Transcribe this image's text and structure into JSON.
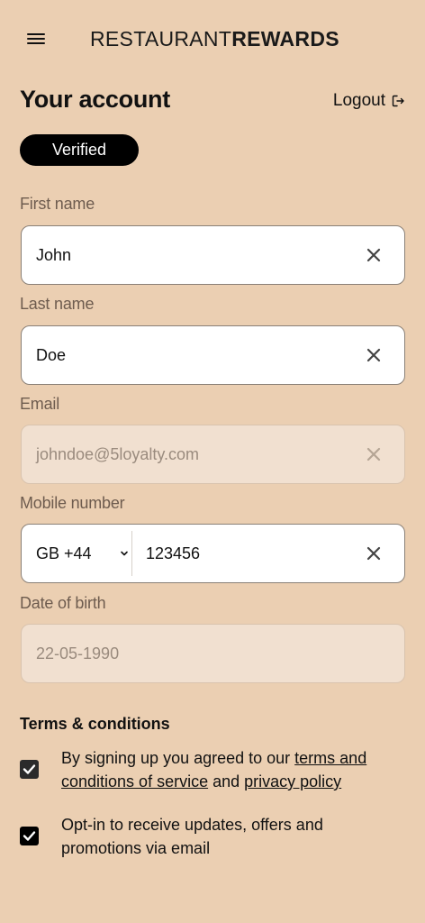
{
  "header": {
    "logo_light": "RESTAURANT",
    "logo_bold": "REWARDS"
  },
  "account": {
    "title": "Your account",
    "logout_label": "Logout",
    "status_badge": "Verified"
  },
  "form": {
    "first_name": {
      "label": "First name",
      "value": "John"
    },
    "last_name": {
      "label": "Last name",
      "value": "Doe"
    },
    "email": {
      "label": "Email",
      "value": "johndoe@5loyalty.com"
    },
    "mobile": {
      "label": "Mobile number",
      "country_code": "GB +44",
      "value": "123456"
    },
    "dob": {
      "label": "Date of birth",
      "value": "22-05-1990"
    }
  },
  "terms": {
    "heading": "Terms & conditions",
    "agreement": {
      "checked": true,
      "prefix": "By signing up you agreed to our ",
      "terms_link": "terms and conditions of service",
      "middle": " and ",
      "privacy_link": "privacy policy"
    },
    "optin": {
      "checked": true,
      "text": "Opt-in to receive updates, offers and promotions via email"
    }
  },
  "icons": {
    "menu": "menu-icon",
    "logout": "logout-icon",
    "clear": "close-icon",
    "chevron": "chevron-down-icon",
    "checkbox": "checkmark-icon"
  }
}
